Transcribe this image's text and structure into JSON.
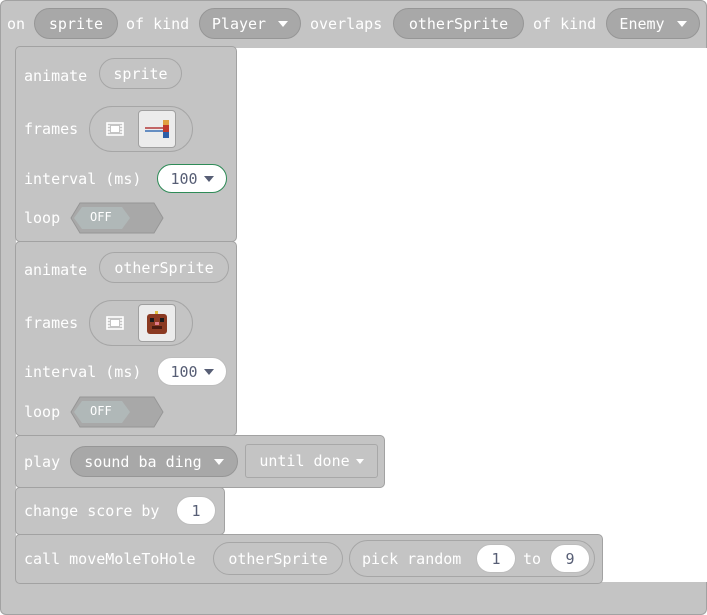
{
  "hat": {
    "on": "on",
    "sprite_var": "sprite",
    "of_kind_1": "of kind",
    "kind_1": "Player",
    "overlaps": "overlaps",
    "other_var": "otherSprite",
    "of_kind_2": "of kind",
    "kind_2": "Enemy"
  },
  "animate1": {
    "animate": "animate",
    "target": "sprite",
    "frames": "frames",
    "interval": "interval (ms)",
    "interval_value": "100",
    "loop": "loop",
    "loop_state": "OFF"
  },
  "animate2": {
    "animate": "animate",
    "target": "otherSprite",
    "frames": "frames",
    "interval": "interval (ms)",
    "interval_value": "100",
    "loop": "loop",
    "loop_state": "OFF"
  },
  "play": {
    "play": "play",
    "sound": "sound ba ding",
    "mode": "until done"
  },
  "score": {
    "label": "change score by",
    "value": "1"
  },
  "call": {
    "label": "call moveMoleToHole",
    "arg": "otherSprite",
    "pick": "pick random",
    "from": "1",
    "to": "to",
    "to_value": "9"
  },
  "colors": {
    "block": "#c4c4c4",
    "block_border": "#a2a2a2",
    "input_text": "#575e75",
    "selected_outline": "#2e8b57"
  },
  "icons": {
    "filmstrip": "filmstrip-icon",
    "sprite1": "player-sprite-thumbnail",
    "sprite2": "mole-sprite-thumbnail",
    "dropdown": "chevron-down-icon"
  }
}
